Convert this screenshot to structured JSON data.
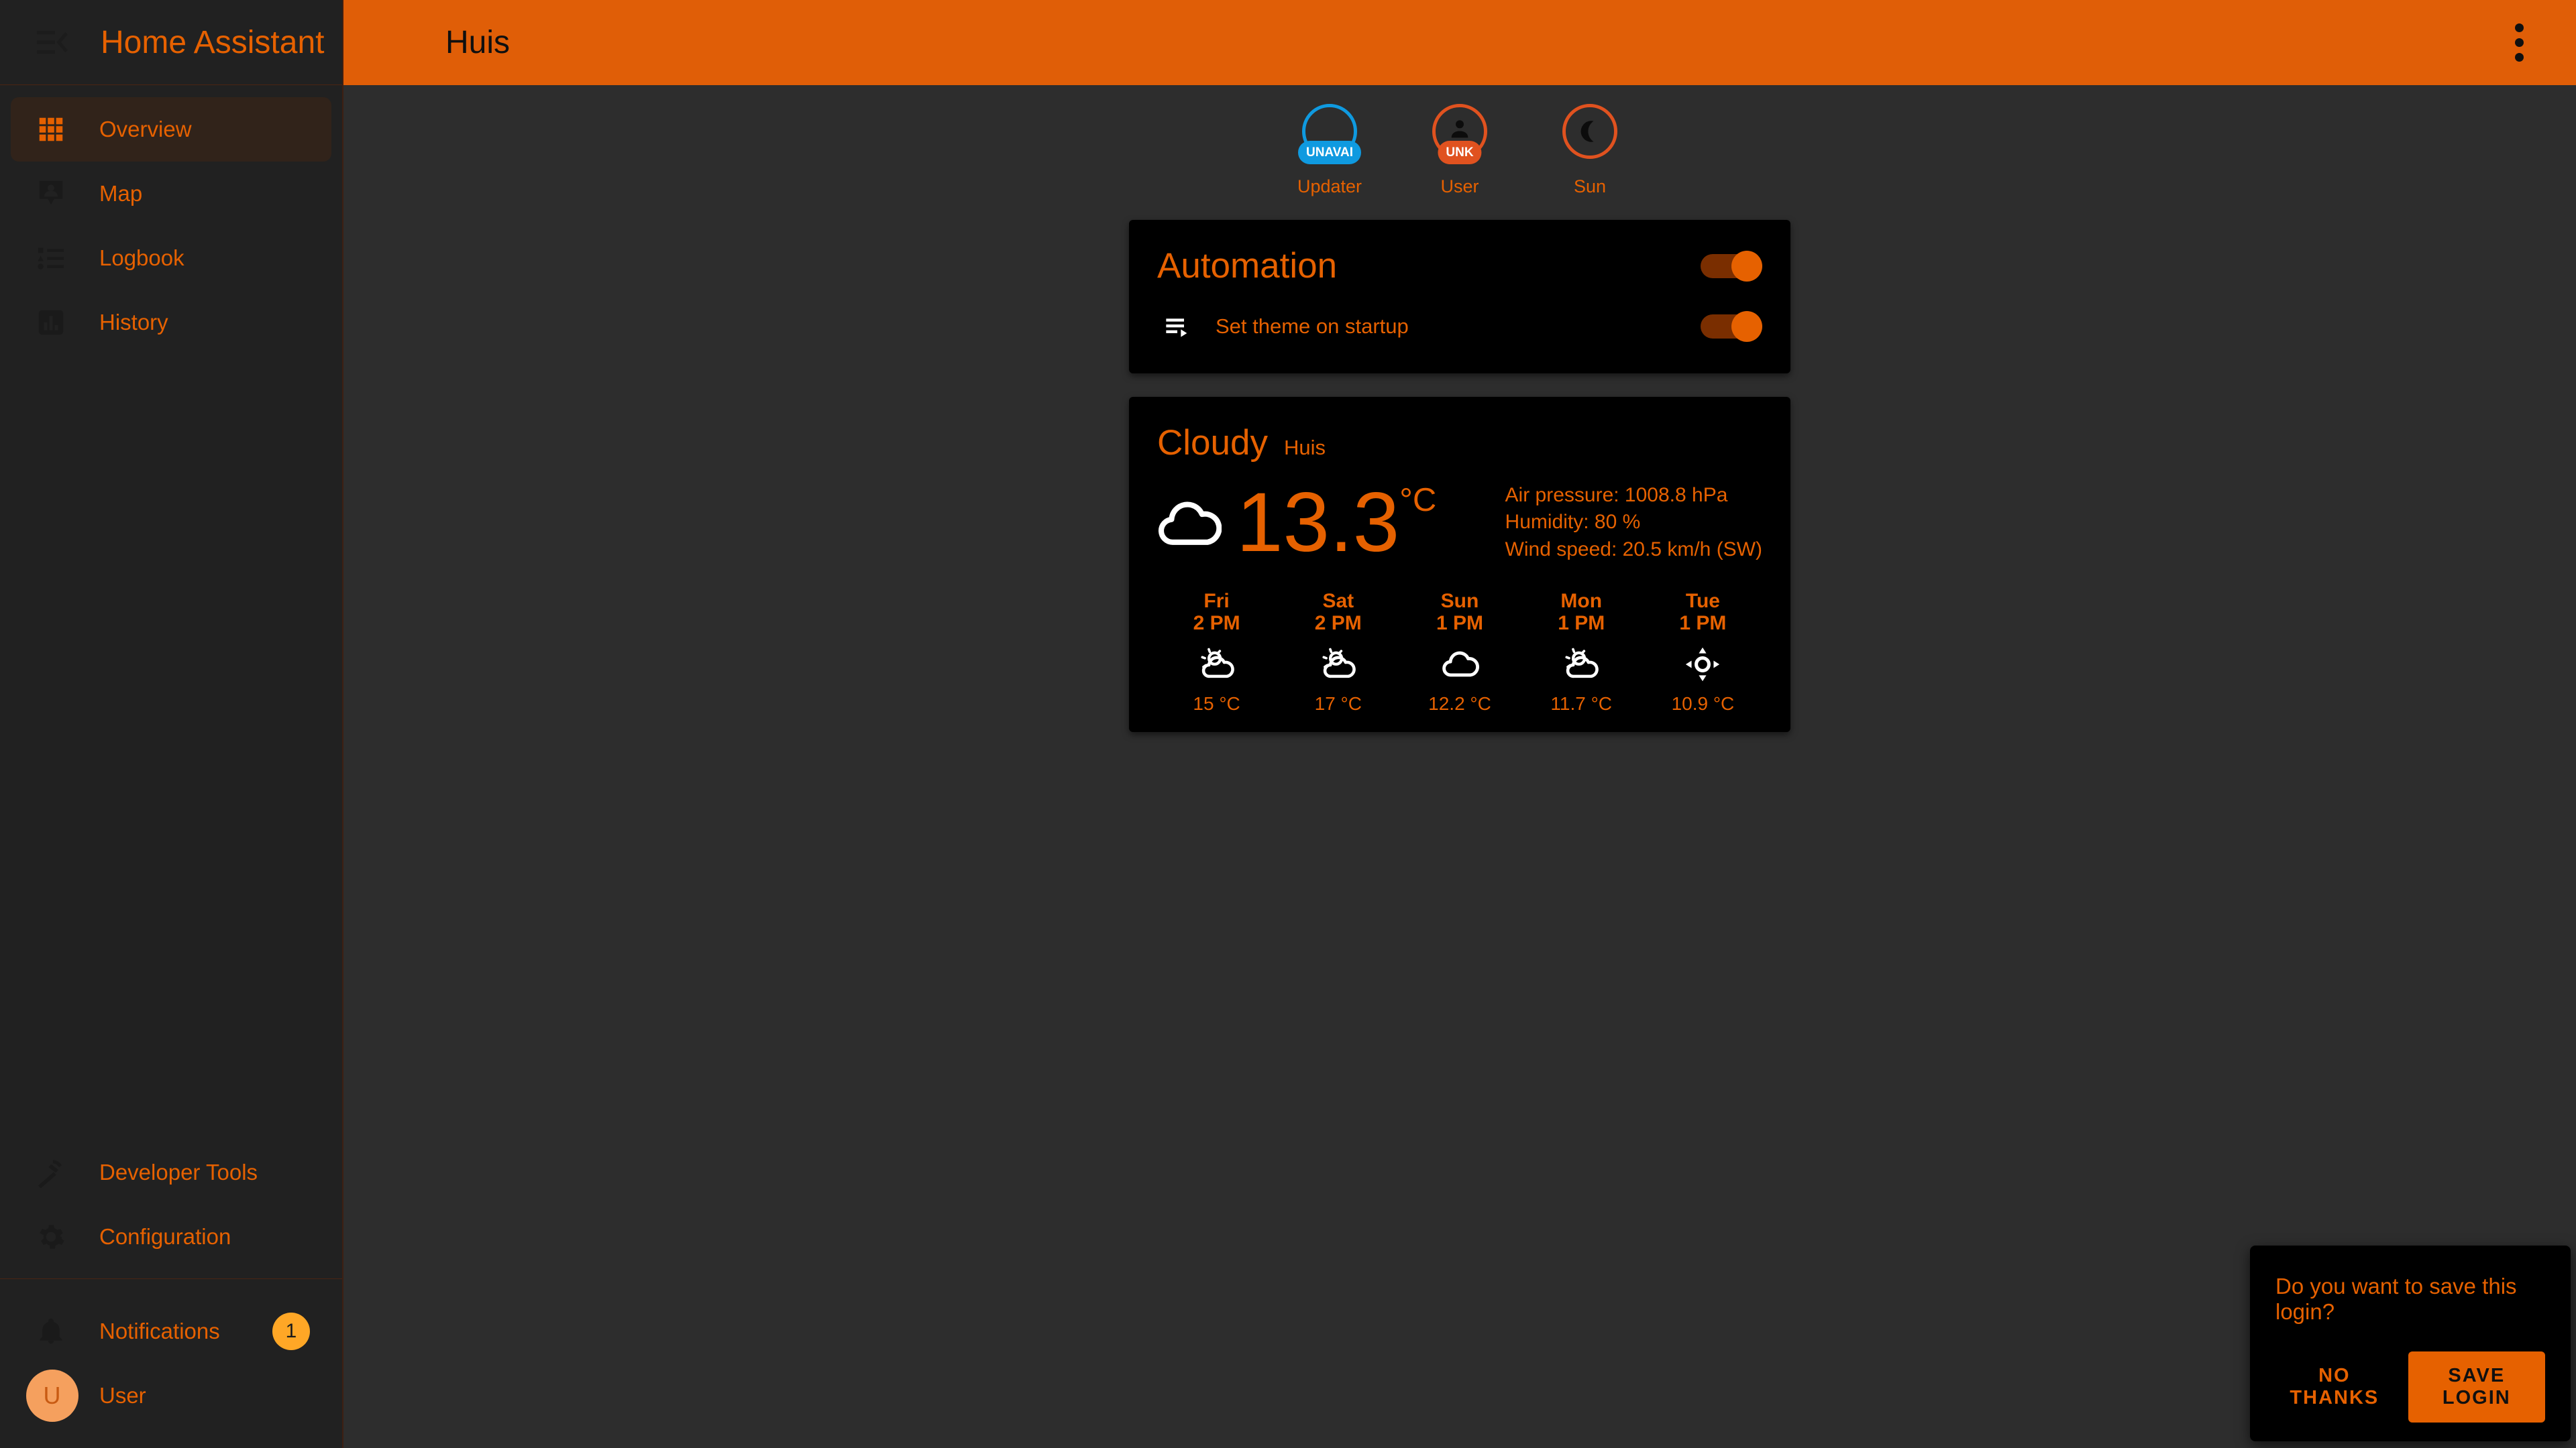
{
  "sidebar": {
    "title": "Home Assistant",
    "menu_icon": "menu-close-icon",
    "items": [
      {
        "label": "Overview",
        "icon": "view-dashboard-icon",
        "active": true
      },
      {
        "label": "Map",
        "icon": "map-marker-account-icon",
        "active": false
      },
      {
        "label": "Logbook",
        "icon": "format-list-bulleted-type-icon",
        "active": false
      },
      {
        "label": "History",
        "icon": "chart-box-icon",
        "active": false
      }
    ],
    "bottom_items": [
      {
        "label": "Developer Tools",
        "icon": "hammer-icon"
      },
      {
        "label": "Configuration",
        "icon": "gear-icon"
      }
    ],
    "notifications": {
      "label": "Notifications",
      "icon": "bell-icon",
      "count": "1"
    },
    "user": {
      "label": "User",
      "avatar_initial": "U"
    }
  },
  "topbar": {
    "title": "Huis",
    "overflow_icon": "dots-vertical-icon"
  },
  "badges": [
    {
      "name": "Updater",
      "state": "UNAVAI",
      "icon": "blank-icon",
      "color": "#0f9ae0"
    },
    {
      "name": "User",
      "state": "UNK",
      "icon": "account-icon",
      "color": "#e0521f"
    },
    {
      "name": "Sun",
      "state": "",
      "icon": "moon-crescent-icon",
      "color": "#e0521f"
    }
  ],
  "automation_card": {
    "title": "Automation",
    "header_toggle": "on",
    "rows": [
      {
        "name": "Set theme on startup",
        "icon": "playlist-play-icon",
        "toggle": "on"
      }
    ]
  },
  "weather_card": {
    "condition": "Cloudy",
    "location": "Huis",
    "icon": "cloud-icon",
    "temperature": "13.3",
    "unit": "°C",
    "attributes": [
      "Air pressure: 1008.8 hPa",
      "Humidity: 80 %",
      "Wind speed: 20.5 km/h (SW)"
    ],
    "forecast": [
      {
        "day": "Fri",
        "time": "2 PM",
        "icon": "partly-cloudy-icon",
        "temp": "15 °C"
      },
      {
        "day": "Sat",
        "time": "2 PM",
        "icon": "partly-cloudy-icon",
        "temp": "17 °C"
      },
      {
        "day": "Sun",
        "time": "1 PM",
        "icon": "cloud-icon",
        "temp": "12.2 °C"
      },
      {
        "day": "Mon",
        "time": "1 PM",
        "icon": "partly-cloudy-icon",
        "temp": "11.7 °C"
      },
      {
        "day": "Tue",
        "time": "1 PM",
        "icon": "sunny-icon",
        "temp": "10.9 °C"
      }
    ]
  },
  "save_login": {
    "message": "Do you want to save this login?",
    "decline_label": "NO THANKS",
    "accept_label": "SAVE LOGIN"
  },
  "colors": {
    "accent": "#e66100",
    "topbar": "#e05e07",
    "sidebar_bg": "#212121",
    "content_bg": "#2d2d2d",
    "card_bg": "#000000",
    "badge_blue": "#0f9ae0",
    "badge_orange": "#e0521f",
    "notification_badge": "#ffa726"
  }
}
